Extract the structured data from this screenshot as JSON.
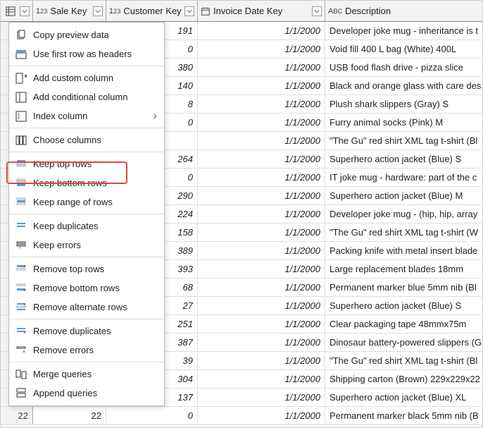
{
  "columns": {
    "sale_key": "Sale Key",
    "customer_key": "Customer Key",
    "invoice_date": "Invoice Date Key",
    "description": "Description"
  },
  "menu": {
    "copy_preview": "Copy preview data",
    "first_row_headers": "Use first row as headers",
    "add_custom": "Add custom column",
    "add_conditional": "Add conditional column",
    "index_column": "Index column",
    "choose_columns": "Choose columns",
    "keep_top": "Keep top rows",
    "keep_bottom": "Keep bottom rows",
    "keep_range": "Keep range of rows",
    "keep_duplicates": "Keep duplicates",
    "keep_errors": "Keep errors",
    "remove_top": "Remove top rows",
    "remove_bottom": "Remove bottom rows",
    "remove_alternate": "Remove alternate rows",
    "remove_duplicates": "Remove duplicates",
    "remove_errors": "Remove errors",
    "merge_queries": "Merge queries",
    "append_queries": "Append queries"
  },
  "rows": [
    {
      "n": "",
      "sk": "",
      "ck": "191",
      "dt": "1/1/2000",
      "desc": "Developer joke mug - inheritance is t"
    },
    {
      "n": "",
      "sk": "",
      "ck": "0",
      "dt": "1/1/2000",
      "desc": "Void fill 400 L bag (White) 400L"
    },
    {
      "n": "",
      "sk": "",
      "ck": "380",
      "dt": "1/1/2000",
      "desc": "USB food flash drive - pizza slice"
    },
    {
      "n": "",
      "sk": "",
      "ck": "140",
      "dt": "1/1/2000",
      "desc": "Black and orange glass with care des"
    },
    {
      "n": "",
      "sk": "",
      "ck": "8",
      "dt": "1/1/2000",
      "desc": "Plush shark slippers (Gray) S"
    },
    {
      "n": "",
      "sk": "",
      "ck": "0",
      "dt": "1/1/2000",
      "desc": "Furry animal socks (Pink) M"
    },
    {
      "n": "",
      "sk": "",
      "ck": "",
      "dt": "1/1/2000",
      "desc": "\"The Gu\" red shirt XML tag t-shirt (Bl"
    },
    {
      "n": "",
      "sk": "",
      "ck": "264",
      "dt": "1/1/2000",
      "desc": "Superhero action jacket (Blue) S"
    },
    {
      "n": "",
      "sk": "",
      "ck": "0",
      "dt": "1/1/2000",
      "desc": "IT joke mug - hardware: part of the c"
    },
    {
      "n": "",
      "sk": "",
      "ck": "290",
      "dt": "1/1/2000",
      "desc": "Superhero action jacket (Blue) M"
    },
    {
      "n": "",
      "sk": "",
      "ck": "224",
      "dt": "1/1/2000",
      "desc": "Developer joke mug - (hip, hip, array"
    },
    {
      "n": "",
      "sk": "",
      "ck": "158",
      "dt": "1/1/2000",
      "desc": "\"The Gu\" red shirt XML tag t-shirt (W"
    },
    {
      "n": "",
      "sk": "",
      "ck": "389",
      "dt": "1/1/2000",
      "desc": "Packing knife with metal insert blade"
    },
    {
      "n": "",
      "sk": "",
      "ck": "393",
      "dt": "1/1/2000",
      "desc": "Large replacement blades 18mm"
    },
    {
      "n": "",
      "sk": "",
      "ck": "68",
      "dt": "1/1/2000",
      "desc": "Permanent marker blue 5mm nib (Bl"
    },
    {
      "n": "",
      "sk": "",
      "ck": "27",
      "dt": "1/1/2000",
      "desc": "Superhero action jacket (Blue) S"
    },
    {
      "n": "",
      "sk": "",
      "ck": "251",
      "dt": "1/1/2000",
      "desc": "Clear packaging tape 48mmx75m"
    },
    {
      "n": "",
      "sk": "",
      "ck": "387",
      "dt": "1/1/2000",
      "desc": "Dinosaur battery-powered slippers (G"
    },
    {
      "n": "",
      "sk": "",
      "ck": "39",
      "dt": "1/1/2000",
      "desc": "\"The Gu\" red shirt XML tag t-shirt (Bl"
    },
    {
      "n": "",
      "sk": "",
      "ck": "304",
      "dt": "1/1/2000",
      "desc": "Shipping carton (Brown) 229x229x22"
    },
    {
      "n": "",
      "sk": "",
      "ck": "137",
      "dt": "1/1/2000",
      "desc": "Superhero action jacket (Blue) XL"
    },
    {
      "n": "22",
      "sk": "22",
      "ck": "0",
      "dt": "1/1/2000",
      "desc": "Permanent marker black 5mm nib (B"
    }
  ]
}
